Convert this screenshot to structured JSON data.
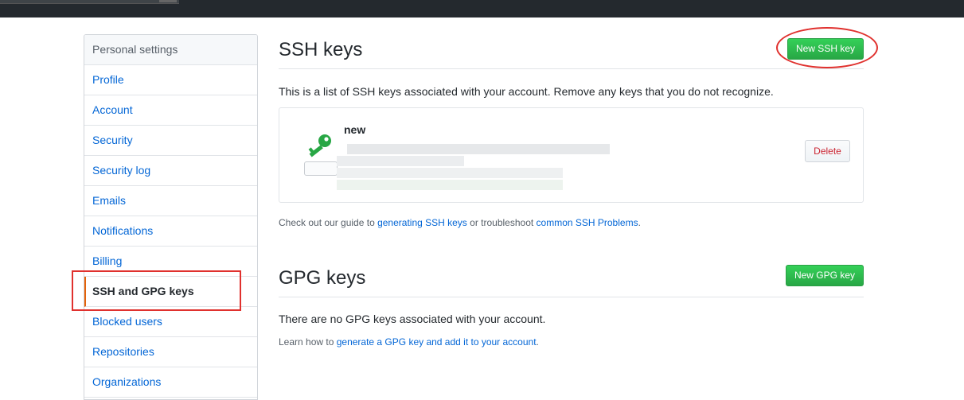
{
  "sidebar": {
    "heading": "Personal settings",
    "items": [
      {
        "label": "Profile"
      },
      {
        "label": "Account"
      },
      {
        "label": "Security"
      },
      {
        "label": "Security log"
      },
      {
        "label": "Emails"
      },
      {
        "label": "Notifications"
      },
      {
        "label": "Billing"
      },
      {
        "label": "SSH and GPG keys",
        "selected": true
      },
      {
        "label": "Blocked users"
      },
      {
        "label": "Repositories"
      },
      {
        "label": "Organizations"
      }
    ]
  },
  "ssh": {
    "title": "SSH keys",
    "new_button": "New SSH key",
    "description": "This is a list of SSH keys associated with your account. Remove any keys that you do not recognize.",
    "key": {
      "title": "new",
      "icon": "key-icon",
      "delete_label": "Delete"
    },
    "footer": {
      "prefix": "Check out our guide to ",
      "link1": "generating SSH keys",
      "middle": " or troubleshoot ",
      "link2": "common SSH Problems",
      "suffix": "."
    }
  },
  "gpg": {
    "title": "GPG keys",
    "new_button": "New GPG key",
    "empty_text": "There are no GPG keys associated with your account.",
    "learn": {
      "prefix": "Learn how to ",
      "link": "generate a GPG key and add it to your account",
      "suffix": "."
    }
  },
  "colors": {
    "link": "#0366d6",
    "green": "#28a745",
    "annotation": "#e0312e",
    "selected_accent": "#e36209",
    "delete_text": "#cb2431"
  }
}
